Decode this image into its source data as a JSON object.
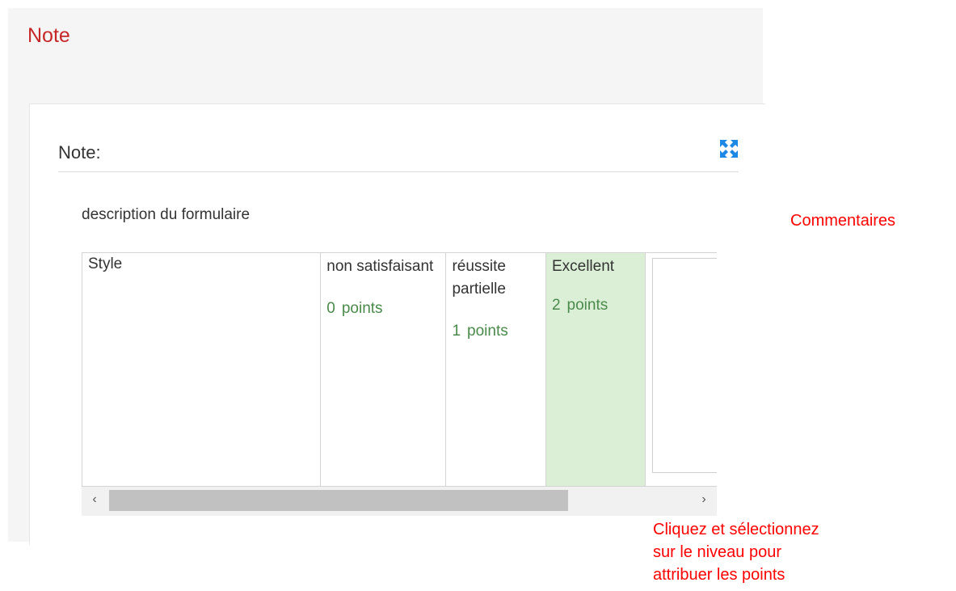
{
  "page": {
    "title": "Note"
  },
  "note_section": {
    "label": "Note:",
    "expand_icon": "expand-arrows-icon",
    "accent_color": "#1e88e5"
  },
  "form": {
    "description": "description du formulaire",
    "rubric": {
      "criterion": "Style",
      "levels": [
        {
          "name": "non satisfaisant",
          "points": "0",
          "points_unit": "points",
          "selected": false
        },
        {
          "name": "réussite partielle",
          "points": "1",
          "points_unit": "points",
          "selected": false
        },
        {
          "name": "Excellent",
          "points": "2",
          "points_unit": "points",
          "selected": true
        }
      ],
      "comment_value": ""
    }
  },
  "scrollbar": {
    "left_arrow": "‹",
    "right_arrow": "›"
  },
  "annotations": {
    "comments": "Commentaires",
    "instructions": [
      "Cliquez et sélectionnez",
      "sur le niveau pour",
      "attribuer les points"
    ]
  },
  "colors": {
    "title_red": "#c62828",
    "annotation_red": "#ff0000",
    "points_green": "#4a8a4a",
    "selected_bg": "#dbefd6"
  }
}
